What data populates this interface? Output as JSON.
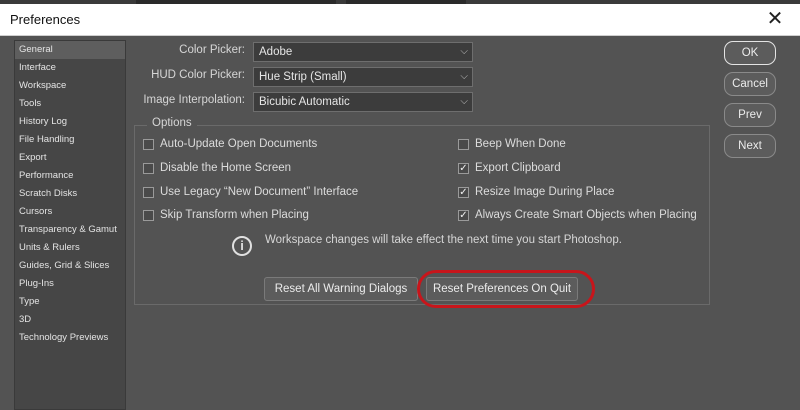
{
  "window": {
    "title": "Preferences",
    "close_glyph": "✕"
  },
  "sidebar": {
    "items": [
      {
        "label": "General"
      },
      {
        "label": "Interface"
      },
      {
        "label": "Workspace"
      },
      {
        "label": "Tools"
      },
      {
        "label": "History Log"
      },
      {
        "label": "File Handling"
      },
      {
        "label": "Export"
      },
      {
        "label": "Performance"
      },
      {
        "label": "Scratch Disks"
      },
      {
        "label": "Cursors"
      },
      {
        "label": "Transparency & Gamut"
      },
      {
        "label": "Units & Rulers"
      },
      {
        "label": "Guides, Grid & Slices"
      },
      {
        "label": "Plug-Ins"
      },
      {
        "label": "Type"
      },
      {
        "label": "3D"
      },
      {
        "label": "Technology Previews"
      }
    ],
    "selected": "General"
  },
  "fields": {
    "color_picker": {
      "label": "Color Picker:",
      "value": "Adobe"
    },
    "hud_color_picker": {
      "label": "HUD Color Picker:",
      "value": "Hue Strip (Small)"
    },
    "image_interpolation": {
      "label": "Image Interpolation:",
      "value": "Bicubic Automatic"
    }
  },
  "options": {
    "title": "Options",
    "left": [
      {
        "label": "Auto-Update Open Documents",
        "checked": false
      },
      {
        "label": "Disable the Home Screen",
        "checked": false
      },
      {
        "label": "Use Legacy “New Document” Interface",
        "checked": false
      },
      {
        "label": "Skip Transform when Placing",
        "checked": false
      }
    ],
    "right": [
      {
        "label": "Beep When Done",
        "checked": false
      },
      {
        "label": "Export Clipboard",
        "checked": true
      },
      {
        "label": "Resize Image During Place",
        "checked": true
      },
      {
        "label": "Always Create Smart Objects when Placing",
        "checked": true
      }
    ],
    "info_text": "Workspace changes will take effect the next time you start Photoshop.",
    "info_icon": "info-icon"
  },
  "buttons": {
    "reset_warnings": "Reset All Warning Dialogs",
    "reset_prefs": "Reset Preferences On Quit",
    "ok": "OK",
    "cancel": "Cancel",
    "prev": "Prev",
    "next": "Next"
  },
  "colors": {
    "dialog_bg": "#535353",
    "highlight": "#c8151b"
  }
}
